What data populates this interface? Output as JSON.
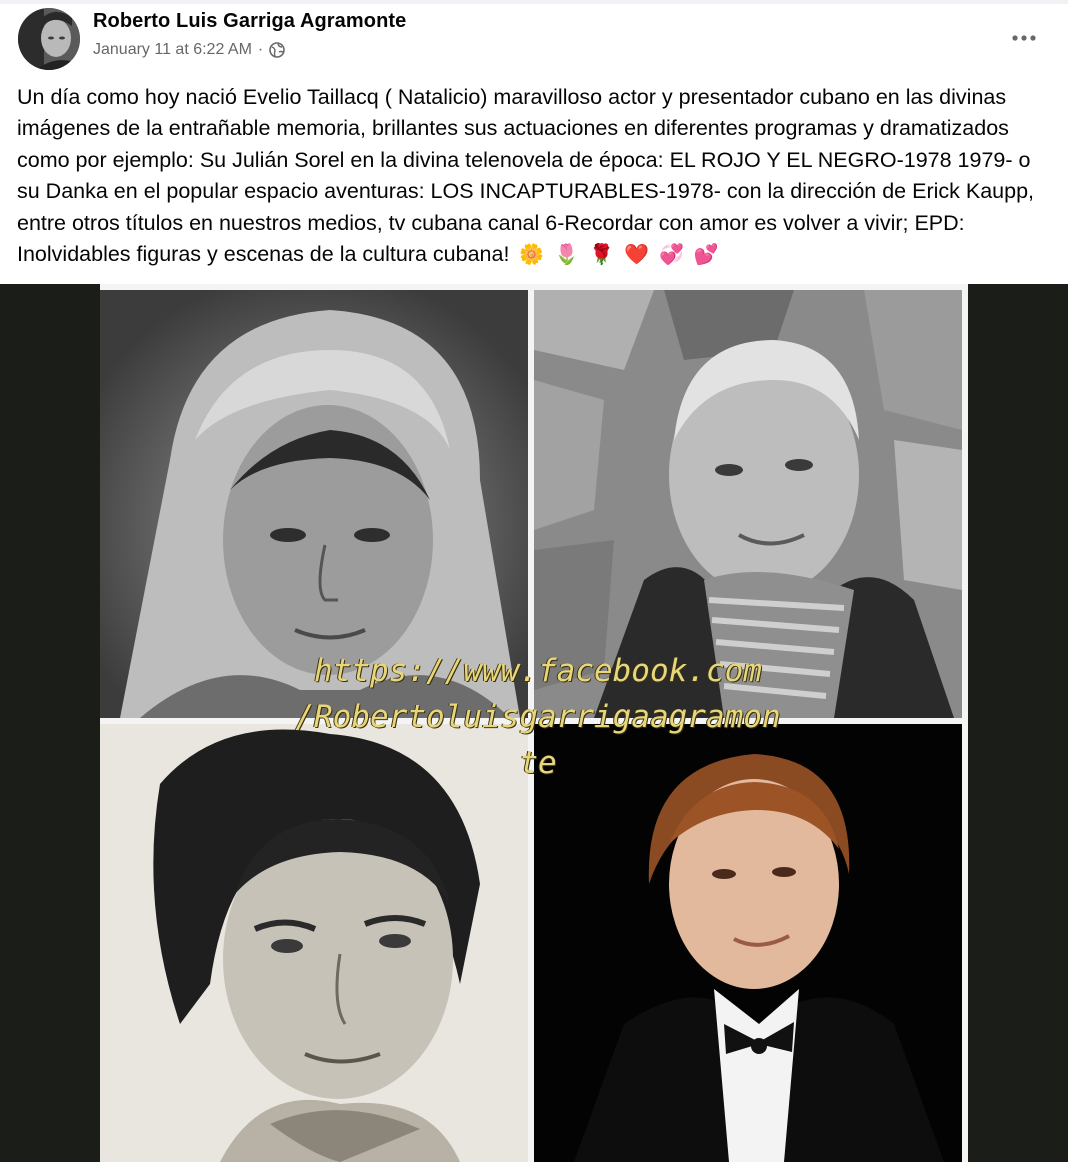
{
  "post": {
    "author_name": "Roberto Luis Garriga Agramonte",
    "timestamp": "January 11 at 6:22 AM",
    "separator": "·",
    "privacy_icon": "globe-icon",
    "more_icon": "more-options-icon",
    "body_text": "Un día como hoy nació Evelio Taillacq ( Natalicio) maravilloso actor y presentador cubano en las divinas imágenes de la entrañable memoria, brillantes sus actuaciones en diferentes programas y dramatizados como por ejemplo: Su Julián Sorel en la divina telenovela de época: EL ROJO Y EL NEGRO-1978 1979-  o su Danka en el popular espacio aventuras: LOS INCAPTURABLES-1978- con la dirección de Erick Kaupp, entre otros títulos en nuestros medios, tv cubana canal 6-Recordar con amor es volver a vivir; EPD: Inolvidables figuras y escenas de la cultura cubana!",
    "emojis": [
      "🌼",
      "🌷",
      "🌹",
      "❤️",
      "💞",
      "💕"
    ]
  },
  "photo": {
    "watermark_lines": [
      "https://www.facebook.com",
      "/Robertoluisgarrigaagramon",
      "te"
    ],
    "panels": [
      "man-in-cap-photo",
      "man-with-scarf-photo",
      "man-with-cravat-photo",
      "man-in-tuxedo-photo"
    ]
  },
  "colors": {
    "text": "#050505",
    "secondary_text": "#65676b",
    "photo_backdrop": "#1b1d18",
    "watermark": "#e8d77a"
  }
}
